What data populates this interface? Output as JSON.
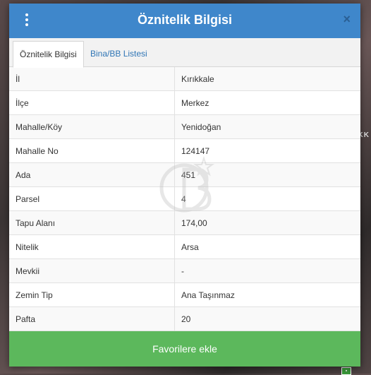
{
  "modal": {
    "title": "Öznitelik Bilgisi",
    "close_glyph": "×"
  },
  "tabs": [
    {
      "label": "Öznitelik Bilgisi",
      "active": true
    },
    {
      "label": "Bina/BB Listesi",
      "active": false
    }
  ],
  "rows": [
    {
      "key": "İl",
      "value": "Kırıkkale"
    },
    {
      "key": "İlçe",
      "value": "Merkez"
    },
    {
      "key": "Mahalle/Köy",
      "value": "Yenidoğan"
    },
    {
      "key": "Mahalle No",
      "value": "124147"
    },
    {
      "key": "Ada",
      "value": "451"
    },
    {
      "key": "Parsel",
      "value": "4"
    },
    {
      "key": "Tapu Alanı",
      "value": "174,00"
    },
    {
      "key": "Nitelik",
      "value": "Arsa"
    },
    {
      "key": "Mevkii",
      "value": "-"
    },
    {
      "key": "Zemin Tip",
      "value": "Ana Taşınmaz"
    },
    {
      "key": "Pafta",
      "value": "20"
    }
  ],
  "footer": {
    "button_label": "Favorilere ekle"
  },
  "background": {
    "side_text": "IKK"
  },
  "colors": {
    "header": "#3f87cb",
    "button": "#5cb85c",
    "tab_link": "#2f75b5"
  }
}
